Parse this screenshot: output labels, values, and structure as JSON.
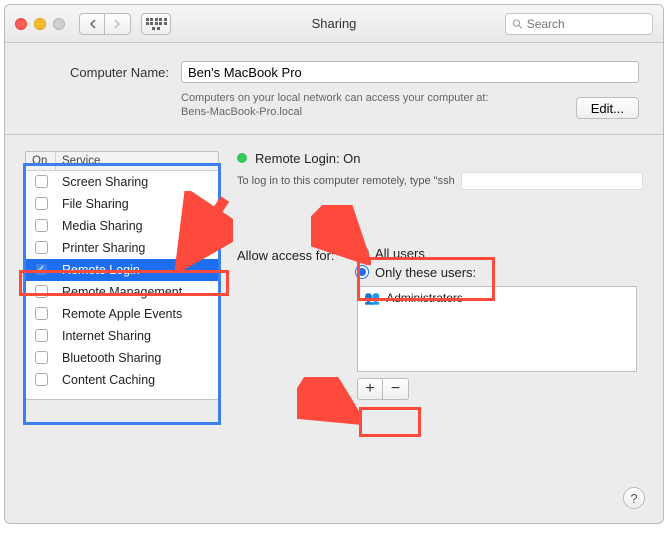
{
  "window": {
    "title": "Sharing"
  },
  "search": {
    "placeholder": "Search"
  },
  "computer_name_label": "Computer Name:",
  "computer_name_value": "Ben's MacBook Pro",
  "help_line1": "Computers on your local network can access your computer at:",
  "help_line2": "Bens-MacBook-Pro.local",
  "edit_label": "Edit...",
  "service_header_on": "On",
  "service_header_name": "Service",
  "services": [
    {
      "name": "Screen Sharing",
      "on": false,
      "selected": false
    },
    {
      "name": "File Sharing",
      "on": false,
      "selected": false
    },
    {
      "name": "Media Sharing",
      "on": false,
      "selected": false
    },
    {
      "name": "Printer Sharing",
      "on": false,
      "selected": false
    },
    {
      "name": "Remote Login",
      "on": true,
      "selected": true
    },
    {
      "name": "Remote Management",
      "on": false,
      "selected": false
    },
    {
      "name": "Remote Apple Events",
      "on": false,
      "selected": false
    },
    {
      "name": "Internet Sharing",
      "on": false,
      "selected": false
    },
    {
      "name": "Bluetooth Sharing",
      "on": false,
      "selected": false
    },
    {
      "name": "Content Caching",
      "on": false,
      "selected": false
    }
  ],
  "status": {
    "label": "Remote Login: On"
  },
  "login_hint_prefix": "To log in to this computer remotely, type \"ssh",
  "access_label": "Allow access for:",
  "radios": {
    "all_users": "All users",
    "only_these": "Only these users:"
  },
  "user_list": {
    "items": [
      {
        "name": "Administrators"
      }
    ]
  },
  "plus": "+",
  "minus": "−",
  "help": "?",
  "annotation_color_red": "#fd4a3d",
  "annotation_color_blue": "#3b7ff1"
}
